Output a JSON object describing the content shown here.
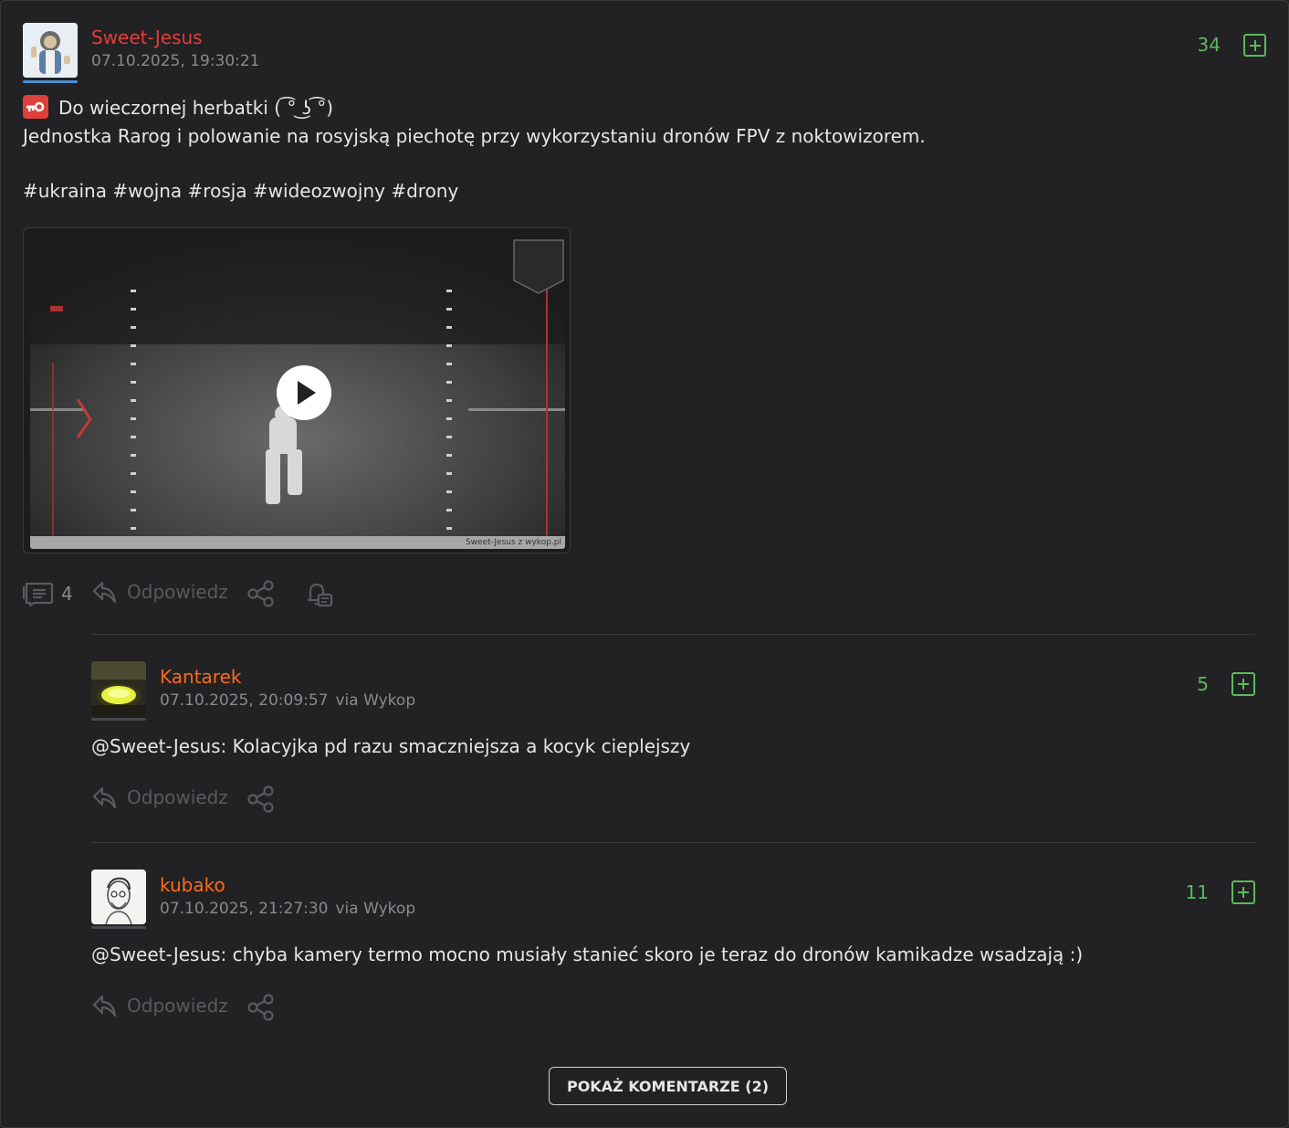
{
  "post": {
    "author": "Sweet-Jesus",
    "date": "07.10.2025, 19:30:21",
    "votes": "34",
    "title_line": "Do wieczornej herbatki ( ͡° ͜ʖ ͡°)",
    "body_line": "Jednostka Rarog i polowanie na rosyjską piechotę przy wykorzystaniu dronów FPV z noktowizorem.",
    "tags": "#ukraina #wojna #rosja #wideozwojny #drony",
    "video_footer": "Sweet-Jesus z wykop.pl",
    "comments_count": "4",
    "reply_label": "Odpowiedz"
  },
  "comments": [
    {
      "author": "Kantarek",
      "date": "07.10.2025, 20:09:57",
      "via": "via Wykop",
      "votes": "5",
      "mention": "@Sweet-Jesus:",
      "text": " Kolacyjka pd razu smaczniejsza a kocyk cieplejszy",
      "reply_label": "Odpowiedz"
    },
    {
      "author": "kubako",
      "date": "07.10.2025, 21:27:30",
      "via": "via Wykop",
      "votes": "11",
      "mention": "@Sweet-Jesus:",
      "text": " chyba kamery termo mocno musiały stanieć skoro je teraz do dronów kamikadze wsadzają :)",
      "reply_label": "Odpowiedz"
    }
  ],
  "show_more_label": "POKAŻ KOMENTARZE (2)",
  "colors": {
    "author_post": "#e0403a",
    "author_comment": "#ff6a1a",
    "vote_green": "#5cb85c",
    "background": "#222224"
  }
}
